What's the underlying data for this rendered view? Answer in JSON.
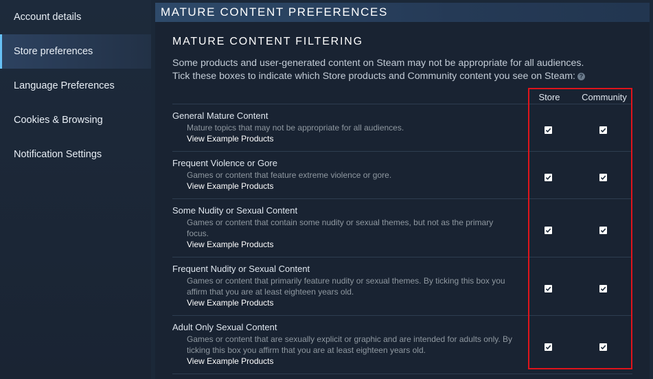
{
  "sidebar": {
    "items": [
      {
        "label": "Account details",
        "active": false
      },
      {
        "label": "Store preferences",
        "active": true
      },
      {
        "label": "Language Preferences",
        "active": false
      },
      {
        "label": "Cookies & Browsing",
        "active": false
      },
      {
        "label": "Notification Settings",
        "active": false
      }
    ]
  },
  "main": {
    "header": "MATURE CONTENT PREFERENCES",
    "subtitle": "MATURE CONTENT FILTERING",
    "description_line1": "Some products and user-generated content on Steam may not be appropriate for all audiences.",
    "description_line2": "Tick these boxes to indicate which Store products and Community content you see on Steam:",
    "help_icon": "?",
    "columns": {
      "store": "Store",
      "community": "Community"
    },
    "rows": [
      {
        "title": "General Mature Content",
        "desc": "Mature topics that may not be appropriate for all audiences.",
        "link": "View Example Products",
        "store_checked": true,
        "community_checked": true
      },
      {
        "title": "Frequent Violence or Gore",
        "desc": "Games or content that feature extreme violence or gore.",
        "link": "View Example Products",
        "store_checked": true,
        "community_checked": true
      },
      {
        "title": "Some Nudity or Sexual Content",
        "desc": "Games or content that contain some nudity or sexual themes, but not as the primary focus.",
        "link": "View Example Products",
        "store_checked": true,
        "community_checked": true
      },
      {
        "title": "Frequent Nudity or Sexual Content",
        "desc": "Games or content that primarily feature nudity or sexual themes. By ticking this box you affirm that you are at least eighteen years old.",
        "link": "View Example Products",
        "store_checked": true,
        "community_checked": true
      },
      {
        "title": "Adult Only Sexual Content",
        "desc": "Games or content that are sexually explicit or graphic and are intended for adults only. By ticking this box you affirm that you are at least eighteen years old.",
        "link": "View Example Products",
        "store_checked": true,
        "community_checked": true
      }
    ]
  },
  "colors": {
    "background": "#1b2838",
    "accent": "#67c1f5",
    "highlight_border": "#e0141b"
  },
  "icons": {
    "checkbox": "check-icon",
    "help": "question-mark-icon"
  }
}
